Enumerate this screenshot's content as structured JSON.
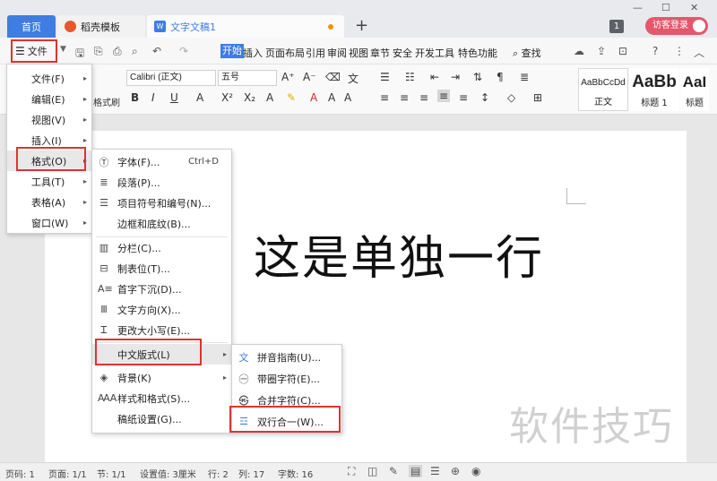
{
  "titlebar": {
    "tabs": [
      {
        "label": "首页"
      },
      {
        "label": "稻壳模板"
      },
      {
        "label": "文字文稿1"
      }
    ],
    "new_tab": "+",
    "window_count": "1",
    "login_label": "访客登录"
  },
  "menubar": {
    "file_label": "文件",
    "ribbon_tabs": [
      "开始",
      "插入",
      "页面布局",
      "引用",
      "审阅",
      "视图",
      "章节",
      "安全",
      "开发工具",
      "特色功能"
    ],
    "search_label": "查找"
  },
  "ribbon": {
    "font_name": "Calibri (正文)",
    "font_size": "五号",
    "format_brush": "格式刷",
    "styles": [
      {
        "preview": "AaBbCcDd",
        "label": "正文"
      },
      {
        "preview": "AaBb",
        "label": "标题 1"
      },
      {
        "preview": "AaI",
        "label": "标题"
      }
    ]
  },
  "document": {
    "body_text": "这是单独一行"
  },
  "file_menu": {
    "items": [
      {
        "label": "文件(F)"
      },
      {
        "label": "编辑(E)"
      },
      {
        "label": "视图(V)"
      },
      {
        "label": "插入(I)"
      },
      {
        "label": "格式(O)"
      },
      {
        "label": "工具(T)"
      },
      {
        "label": "表格(A)"
      },
      {
        "label": "窗口(W)"
      }
    ]
  },
  "format_menu": {
    "items": [
      {
        "label": "字体(F)...",
        "shortcut": "Ctrl+D",
        "icon": "font-icon"
      },
      {
        "label": "段落(P)...",
        "icon": "paragraph-icon"
      },
      {
        "label": "项目符号和编号(N)...",
        "icon": "bullets-icon"
      },
      {
        "label": "边框和底纹(B)..."
      },
      {
        "label": "分栏(C)...",
        "icon": "columns-icon"
      },
      {
        "label": "制表位(T)...",
        "icon": "tab-stops-icon"
      },
      {
        "label": "首字下沉(D)...",
        "icon": "drop-cap-icon"
      },
      {
        "label": "文字方向(X)...",
        "icon": "text-direction-icon"
      },
      {
        "label": "更改大小写(E)...",
        "icon": "change-case-icon"
      },
      {
        "label": "中文版式(L)"
      },
      {
        "label": "背景(K)",
        "icon": "background-icon"
      },
      {
        "label": "样式和格式(S)...",
        "icon": "styles-icon"
      },
      {
        "label": "稿纸设置(G)..."
      }
    ]
  },
  "chinese_layout_menu": {
    "items": [
      {
        "label": "拼音指南(U)...",
        "icon": "pinyin-icon"
      },
      {
        "label": "带圈字符(E)...",
        "icon": "enclosed-char-icon"
      },
      {
        "label": "合并字符(C)...",
        "icon": "combine-chars-icon"
      },
      {
        "label": "双行合一(W)...",
        "icon": "two-lines-in-one-icon"
      }
    ]
  },
  "statusbar": {
    "page_num": "页码: 1",
    "pages": "页面: 1/1",
    "section": "节: 1/1",
    "setting": "设置值: 3厘米",
    "row": "行: 2",
    "col": "列: 17",
    "words": "字数: 16"
  },
  "watermark": "软件技巧"
}
